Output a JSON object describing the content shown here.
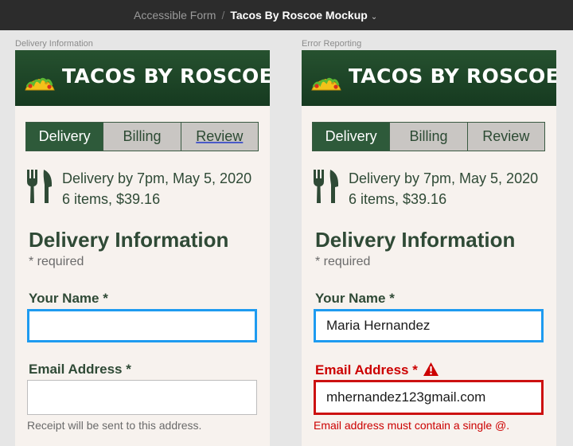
{
  "breadcrumb": {
    "parent": "Accessible Form",
    "separator": "/",
    "current": "Tacos By Roscoe Mockup"
  },
  "frames": [
    {
      "label": "Delivery Information",
      "brand": "TACOS BY ROSCOE",
      "tabs": [
        "Delivery",
        "Billing",
        "Review"
      ],
      "delivery_time": "Delivery by 7pm, May 5, 2020",
      "order_summary": "6 items, $39.16",
      "section_title": "Delivery Information",
      "required_note": "* required",
      "name_label": "Your Name *",
      "name_value": "",
      "email_label": "Email Address *",
      "email_value": "",
      "email_hint": "Receipt will be sent to this address."
    },
    {
      "label": "Error Reporting",
      "brand": "TACOS BY ROSCOE",
      "tabs": [
        "Delivery",
        "Billing",
        "Review"
      ],
      "delivery_time": "Delivery by 7pm, May 5, 2020",
      "order_summary": "6 items, $39.16",
      "section_title": "Delivery Information",
      "required_note": "* required",
      "name_label": "Your Name *",
      "name_value": "Maria Hernandez",
      "email_label": "Email Address *",
      "email_value": "mhernandez123gmail.com",
      "email_error": "Email address must contain a single @."
    }
  ],
  "icons": {
    "brand_logo": "taco-icon",
    "order_icon": "fork-knife-icon",
    "error_icon": "warning-triangle-icon",
    "breadcrumb_menu": "chevron-down-icon"
  },
  "colors": {
    "brand_green": "#1f4a2a",
    "focus_blue": "#1e9bf0",
    "error_red": "#cc1111",
    "page_bg": "#f7f2ee"
  }
}
